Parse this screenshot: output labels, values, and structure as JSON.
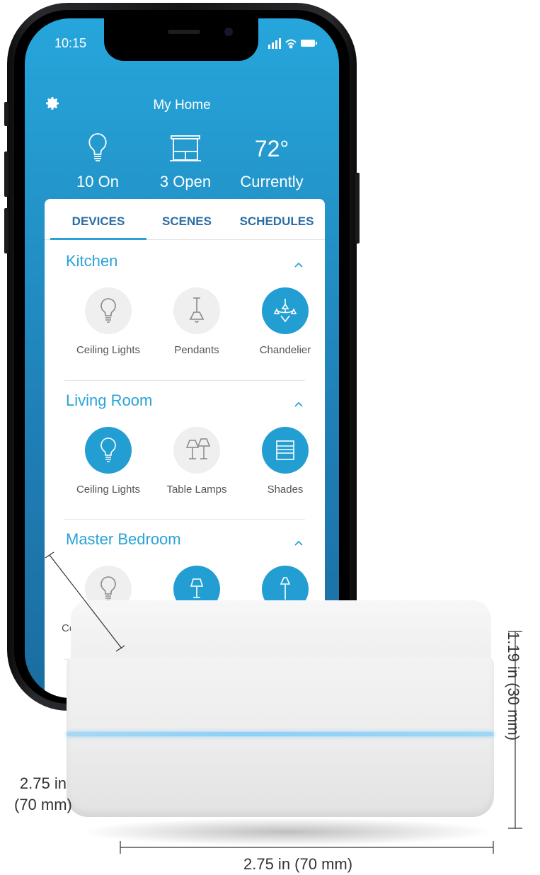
{
  "status_bar": {
    "time": "10:15"
  },
  "header": {
    "title": "My Home",
    "settings_icon": "gear-icon"
  },
  "summary": [
    {
      "icon": "bulb-icon",
      "label": "10 On"
    },
    {
      "icon": "window-icon",
      "label": "3 Open"
    },
    {
      "value": "72°",
      "label": "Currently"
    }
  ],
  "tabs": [
    {
      "label": "DEVICES",
      "active": true
    },
    {
      "label": "SCENES"
    },
    {
      "label": "SCHEDULES"
    }
  ],
  "rooms": [
    {
      "name": "Kitchen",
      "devices": [
        {
          "name": "Ceiling Lights",
          "icon": "bulb-icon",
          "on": false
        },
        {
          "name": "Pendants",
          "icon": "pendant-icon",
          "on": false
        },
        {
          "name": "Chandelier",
          "icon": "chandelier-icon",
          "on": true
        }
      ]
    },
    {
      "name": "Living Room",
      "devices": [
        {
          "name": "Ceiling Lights",
          "icon": "bulb-icon",
          "on": true
        },
        {
          "name": "Table Lamps",
          "icon": "table-lamps-icon",
          "on": false
        },
        {
          "name": "Shades",
          "icon": "shades-icon",
          "on": true
        }
      ]
    },
    {
      "name": "Master Bedroom",
      "devices": [
        {
          "name": "Ce",
          "icon": "bulb-icon",
          "on": false
        },
        {
          "name": "",
          "icon": "lamp-icon",
          "on": true
        },
        {
          "name": "",
          "icon": "floor-lamp-icon",
          "on": true
        }
      ]
    }
  ],
  "dimensions": {
    "height": "1.19 in (30 mm)",
    "depth_line1": "2.75 in",
    "depth_line2": "(70 mm)",
    "width": "2.75 in (70 mm)"
  },
  "colors": {
    "accent": "#2aa2d8",
    "active_circle": "#239ed3",
    "tab_text": "#2b6da3",
    "led": "#8fd0f7"
  }
}
